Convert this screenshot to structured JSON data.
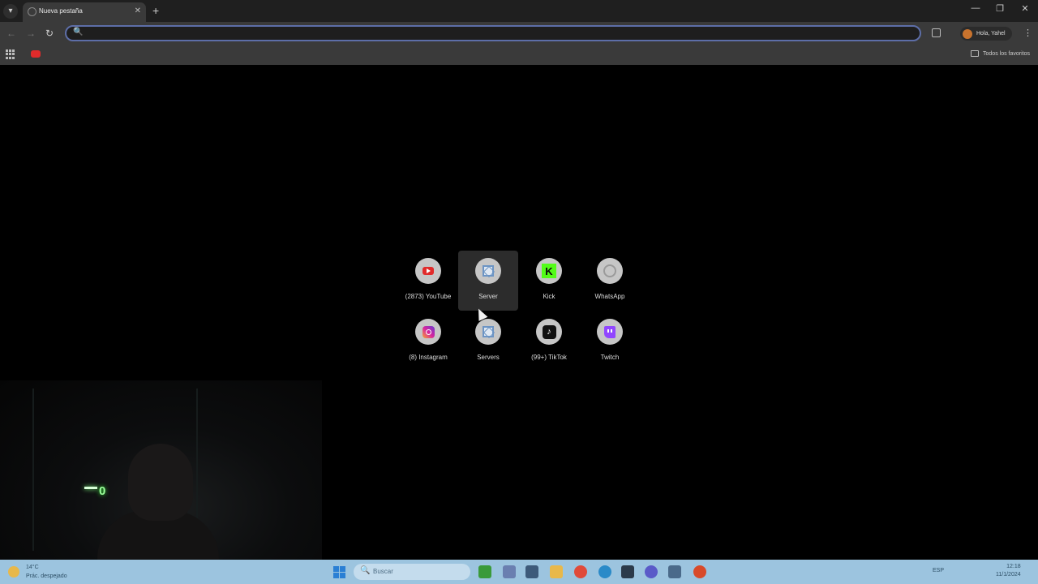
{
  "browser": {
    "tab_title": "Nueva pestaña",
    "new_tab_symbol": "+",
    "tab_close_symbol": "✕",
    "omnibox_value": "",
    "omnibox_placeholder": "",
    "profile_name": "Hola, Yahel",
    "all_bookmarks_label": "Todos los favoritos",
    "window_controls": {
      "minimize": "—",
      "restore": "❐",
      "close": "✕"
    },
    "nav_symbols": {
      "back": "←",
      "forward": "→",
      "reload": "↻",
      "menu": "⋮",
      "search": "🔍"
    }
  },
  "shortcuts": [
    {
      "label": "(2873) YouTube",
      "icon": "youtube-icon"
    },
    {
      "label": "Server",
      "icon": "server-icon",
      "hovered": true
    },
    {
      "label": "Kick",
      "icon": "kick-icon",
      "glyph": "K"
    },
    {
      "label": "WhatsApp",
      "icon": "whatsapp-icon"
    },
    {
      "label": "(8) Instagram",
      "icon": "instagram-icon"
    },
    {
      "label": "Servers",
      "icon": "server-icon"
    },
    {
      "label": "(99+) TikTok",
      "icon": "tiktok-icon",
      "glyph": "♪"
    },
    {
      "label": "Twitch",
      "icon": "twitch-icon"
    }
  ],
  "webcam": {
    "overlay_digit": "0"
  },
  "taskbar": {
    "search_placeholder": "Buscar",
    "weather_temp": "14°C",
    "weather_desc": "Prác. despejado",
    "tray_lang": "ESP",
    "clock_time": "12:18",
    "clock_date": "11/1/2024",
    "apps": [
      "file-explorer-icon",
      "chrome-icon",
      "edge-icon",
      "store-icon",
      "settings-icon",
      "security-icon",
      "steam-icon",
      "discord-icon"
    ]
  },
  "colors": {
    "accent": "#5d6ea8",
    "taskbar": "#9cc4df",
    "youtube_red": "#e12b2b",
    "kick_green": "#53fc18",
    "twitch_purple": "#9146ff"
  }
}
